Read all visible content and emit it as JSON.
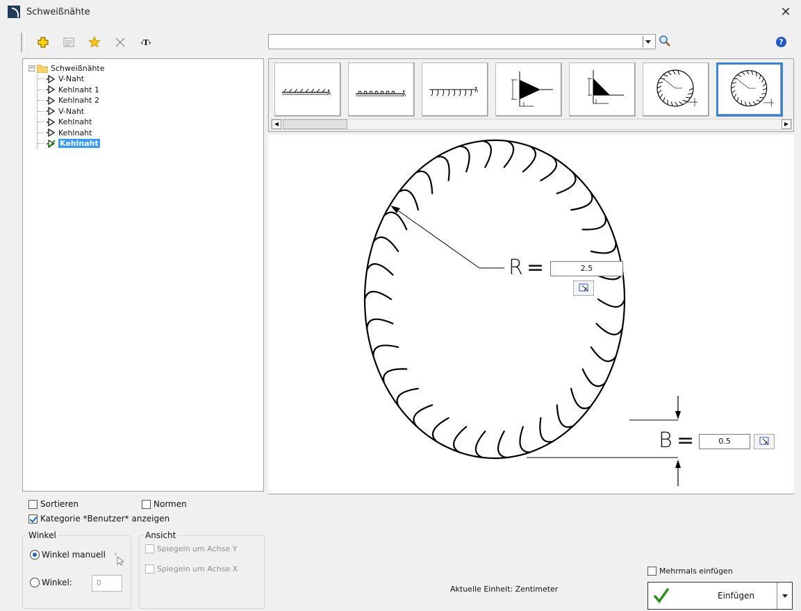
{
  "window": {
    "title": "Schweißnähte",
    "close_icon": "close-icon"
  },
  "toolbar": {
    "items": [
      "add-icon",
      "properties-icon",
      "favorite-star-icon",
      "delete-icon",
      "text-tag-icon"
    ],
    "text_tag_label": "‹T›"
  },
  "search": {
    "value": "",
    "placeholder": ""
  },
  "tree": {
    "root": "Schweißnähte",
    "items": [
      {
        "label": "V-Naht",
        "selected": false
      },
      {
        "label": "Kehlnaht 1",
        "selected": false
      },
      {
        "label": "Kehlnaht 2",
        "selected": false
      },
      {
        "label": "V-Naht",
        "selected": false
      },
      {
        "label": "Kehlnaht",
        "selected": false
      },
      {
        "label": "Kehlnaht",
        "selected": false
      },
      {
        "label": "Kehlnaht",
        "selected": true
      }
    ]
  },
  "thumbnails": {
    "count": 7,
    "selected_index": 6,
    "types": [
      "weld-line-1",
      "weld-line-2",
      "weld-line-3",
      "v-weld-profile",
      "fillet-weld-profile",
      "circular-weld-open",
      "circular-weld-closed"
    ]
  },
  "drawing": {
    "r_label": "R",
    "r_value": "2.5",
    "b_label": "B",
    "b_value": "0.5",
    "equals": "="
  },
  "options": {
    "sort_label": "Sortieren",
    "sort_checked": false,
    "norms_label": "Normen",
    "norms_checked": false,
    "user_category_label": "Kategorie *Benutzer* anzeigen",
    "user_category_checked": true
  },
  "angle_group": {
    "title": "Winkel",
    "manual_label": "Winkel manuell",
    "manual_selected": true,
    "angle_label": "Winkel:",
    "angle_value": "0"
  },
  "view_group": {
    "title": "Ansicht",
    "mirror_y_label": "Spiegeln um Achse Y",
    "mirror_x_label": "Spiegeln um Achse X"
  },
  "status": {
    "unit_text": "Aktuelle Einheit: Zentimeter"
  },
  "insert": {
    "multiple_label": "Mehrmals einfügen",
    "multiple_checked": false,
    "button_label": "Einfügen"
  },
  "colors": {
    "accent": "#3399ff",
    "selected_border": "#3a83d6",
    "check_green": "#2e8b1e"
  }
}
